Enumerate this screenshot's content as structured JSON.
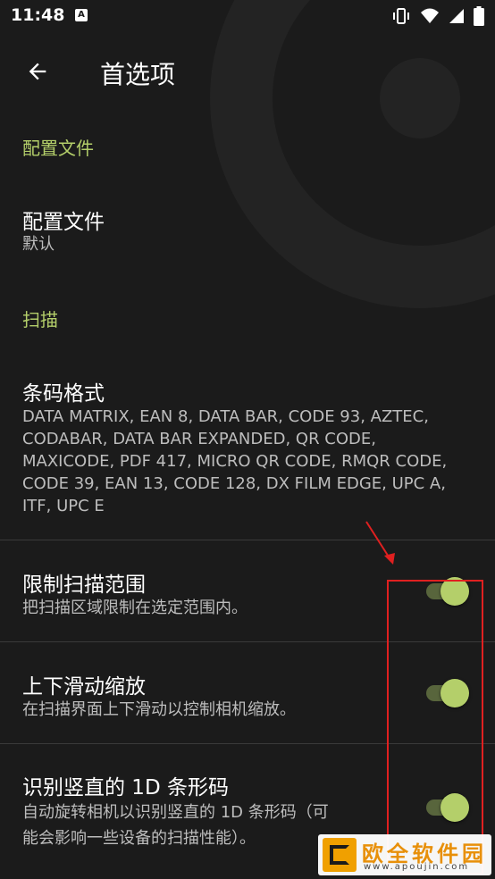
{
  "status_bar": {
    "time": "11:48",
    "notification_glyph": "A",
    "icons": [
      "vibrate-icon",
      "wifi-icon",
      "signal-icon",
      "battery-icon"
    ]
  },
  "app_bar": {
    "back_icon": "arrow-back-icon",
    "title": "首选项"
  },
  "sections": [
    {
      "category": "配置文件",
      "items": [
        {
          "title": "配置文件",
          "summary": "默认"
        }
      ]
    },
    {
      "category": "扫描",
      "items": [
        {
          "title": "条码格式",
          "summary_lines": [
            "DATA MATRIX, EAN 8, DATA BAR, CODE 93, AZTEC,",
            "CODABAR, DATA BAR EXPANDED, QR CODE,",
            "MAXICODE, PDF 417, MICRO QR CODE, RMQR CODE,",
            "CODE 39, EAN 13, CODE 128, DX FILM EDGE, UPC A,",
            "ITF, UPC E"
          ]
        },
        {
          "title": "限制扫描范围",
          "summary": "把扫描区域限制在选定范围内。",
          "switch_on": true
        },
        {
          "title": "上下滑动缩放",
          "summary": "在扫描界面上下滑动以控制相机缩放。",
          "switch_on": true
        },
        {
          "title": "识别竖直的 1D 条形码",
          "summary_lines": [
            "自动旋转相机以识别竖直的 1D 条形码（可",
            "能会影响一些设备的扫描性能）。"
          ],
          "switch_on": true
        }
      ]
    }
  ],
  "watermark": {
    "name": "欧全软件园",
    "url": "www.apoujin.com"
  },
  "colors": {
    "background": "#1b1b1b",
    "accent": "#b4cf6a",
    "switch_track": "#58653c",
    "annotation_red": "#e02020"
  }
}
